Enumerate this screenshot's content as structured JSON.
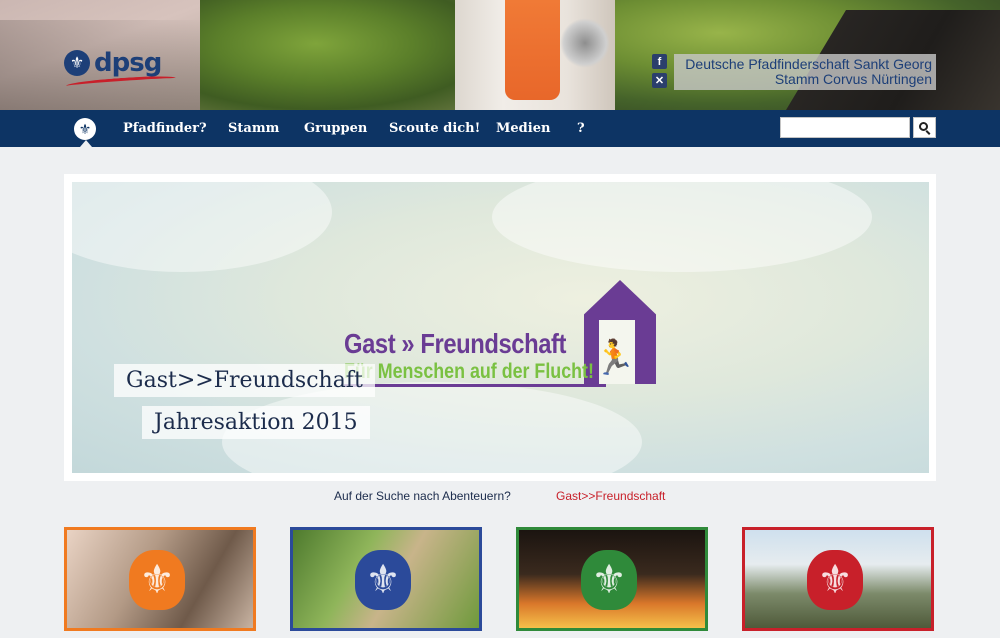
{
  "header": {
    "logo_text": "dpsg",
    "org_line1": "Deutsche Pfadfinderschaft Sankt Georg",
    "org_line2": "Stamm Corvus Nürtingen",
    "social_facebook_glyph": "f",
    "social_xing_glyph": "✕"
  },
  "nav": {
    "home_glyph": "⚜",
    "items": [
      {
        "label": "Pfadfinder?"
      },
      {
        "label": "Stamm"
      },
      {
        "label": "Gruppen"
      },
      {
        "label": "Scoute dich!"
      },
      {
        "label": "Medien"
      },
      {
        "label": "?"
      }
    ],
    "search_value": ""
  },
  "slider": {
    "logo_title": "Gast » Freundschaft",
    "logo_subtitle": "Für Menschen auf der Flucht!",
    "caption_line1": "Gast>>Freundschaft",
    "caption_line2": "Jahresaktion 2015",
    "links": [
      {
        "label": "Auf der Suche nach Abenteuern?"
      },
      {
        "label": "Gast>>Freundschaft"
      }
    ]
  },
  "tiles": [
    {
      "color": "#f07a20",
      "lily_color": "#f07a20"
    },
    {
      "color": "#2b4a9a",
      "lily_color": "#2b4a9a"
    },
    {
      "color": "#2f8a3a",
      "lily_color": "#2f8a3a"
    },
    {
      "color": "#c8202a",
      "lily_color": "#c8202a"
    }
  ],
  "colors": {
    "nav_bg": "#0d3464",
    "brand_purple": "#6a3c94",
    "brand_green": "#7ac142",
    "link_red": "#c8202a"
  },
  "icons": {
    "search": "search-icon",
    "facebook": "facebook-icon",
    "xing": "xing-icon",
    "home": "lily-icon"
  }
}
